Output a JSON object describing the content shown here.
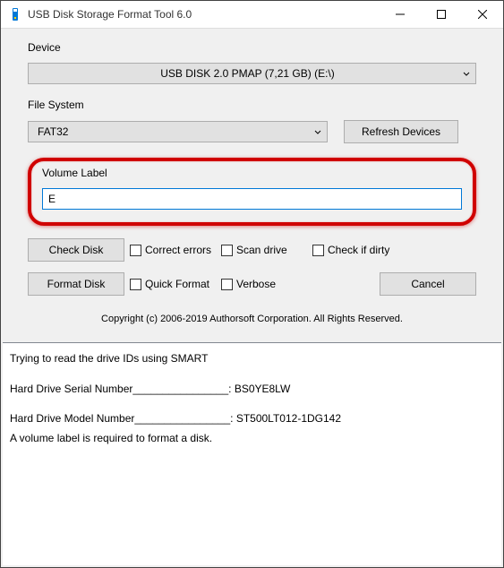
{
  "titlebar": {
    "title": "USB Disk Storage Format Tool 6.0"
  },
  "device": {
    "label": "Device",
    "selected": "USB DISK 2.0  PMAP (7,21 GB) (E:\\)"
  },
  "filesystem": {
    "label": "File System",
    "selected": "FAT32",
    "refresh_label": "Refresh Devices"
  },
  "volume": {
    "label": "Volume Label",
    "value": "E"
  },
  "actions": {
    "check_disk": "Check Disk",
    "correct_errors": "Correct errors",
    "scan_drive": "Scan drive",
    "check_if_dirty": "Check if dirty",
    "format_disk": "Format Disk",
    "quick_format": "Quick Format",
    "verbose": "Verbose",
    "cancel": "Cancel"
  },
  "copyright": "Copyright (c) 2006-2019 Authorsoft Corporation. All Rights Reserved.",
  "log": {
    "line1": "Trying to read the drive IDs using SMART",
    "line2": "Hard Drive Serial Number________________: BS0YE8LW",
    "line3": "Hard Drive Model Number________________: ST500LT012-1DG142",
    "line4": "A volume label is required to format a disk."
  }
}
